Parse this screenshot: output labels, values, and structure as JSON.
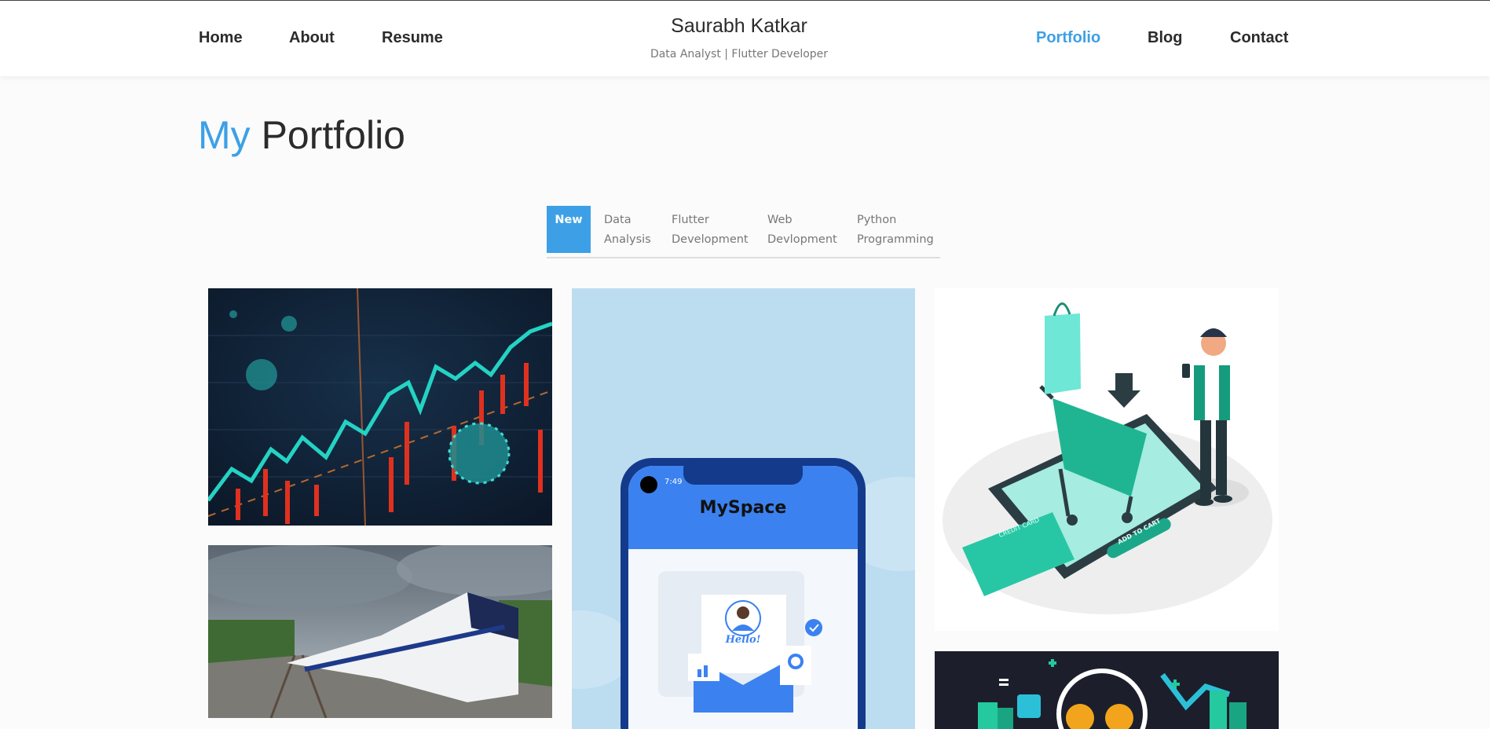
{
  "header": {
    "brand_name": "Saurabh Katkar",
    "brand_tagline": "Data Analyst | Flutter Developer",
    "nav_left": [
      {
        "label": "Home"
      },
      {
        "label": "About"
      },
      {
        "label": "Resume"
      }
    ],
    "nav_right": [
      {
        "label": "Portfolio",
        "active": true
      },
      {
        "label": "Blog"
      },
      {
        "label": "Contact"
      }
    ]
  },
  "main": {
    "title_accent": "My",
    "title_rest": "Portfolio",
    "filters": [
      {
        "line1": "New",
        "line2": "",
        "active": true
      },
      {
        "line1": "Data",
        "line2": "Analysis"
      },
      {
        "line1": "Flutter",
        "line2": "Development"
      },
      {
        "line1": "Web",
        "line2": "Devlopment"
      },
      {
        "line1": "Python",
        "line2": "Programming"
      }
    ],
    "cards": {
      "phone_app_title": "MySpace",
      "phone_time": "7:49",
      "phone_greeting": "Hello!",
      "shop_card_text": "CREDIT CARD",
      "shop_button_text": "ADD TO CART"
    }
  },
  "colors": {
    "accent": "#3da0e6",
    "text_dark": "#2b2b2b",
    "text_muted": "#777777"
  }
}
